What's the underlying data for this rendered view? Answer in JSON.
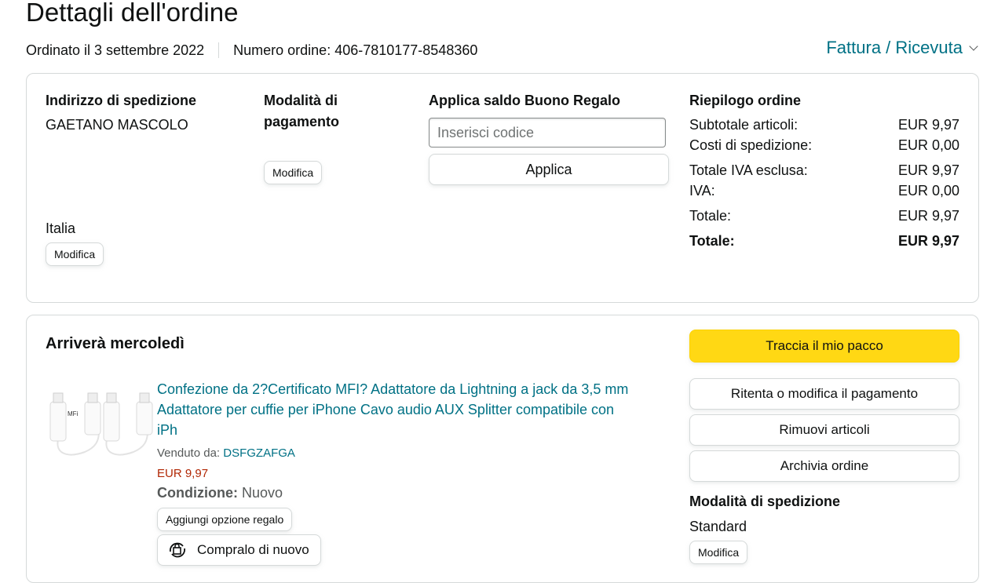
{
  "page": {
    "title": "Dettagli dell'ordine",
    "ordered_on": "Ordinato il 3 settembre 2022",
    "order_number": "Numero ordine: 406-7810177-8548360",
    "invoice_label": "Fattura / Ricevuta"
  },
  "shipping_address": {
    "heading": "Indirizzo di spedizione",
    "name": "GAETANO MASCOLO",
    "country": "Italia",
    "edit_label": "Modifica"
  },
  "payment": {
    "heading_line1": "Modalità di",
    "heading_line2": "pagamento",
    "edit_label": "Modifica"
  },
  "gift_card": {
    "heading": "Applica saldo Buono Regalo",
    "placeholder": "Inserisci codice",
    "apply_label": "Applica"
  },
  "summary": {
    "heading": "Riepilogo ordine",
    "rows": [
      {
        "label": "Subtotale articoli:",
        "value": "EUR 9,97"
      },
      {
        "label": "Costi di spedizione:",
        "value": "EUR 0,00"
      },
      {
        "label": "Totale IVA esclusa:",
        "value": "EUR 9,97"
      },
      {
        "label": "IVA:",
        "value": "EUR 0,00"
      },
      {
        "label": "Totale:",
        "value": "EUR 9,97"
      },
      {
        "label": "Totale:",
        "value": "EUR 9,97"
      }
    ]
  },
  "shipment": {
    "heading": "Arriverà mercoledì",
    "item": {
      "title_line1": "Confezione da 2?Certificato MFI? Adattatore da Lightning a jack da 3,5 mm",
      "title_line2": "Adattatore per cuffie per iPhone Cavo audio AUX Splitter compatibile con",
      "title_line3": "iPh",
      "sold_by_label": "Venduto da:",
      "seller": "DSFGZAFGA",
      "price": "EUR 9,97",
      "condition_label": "Condizione:",
      "condition_value": "Nuovo",
      "gift_option_label": "Aggiungi opzione regalo",
      "buy_again_label": "Compralo di nuovo",
      "thumb_mark": "MFi"
    },
    "actions": {
      "track": "Traccia il mio pacco",
      "retry_payment": "Ritenta o modifica il pagamento",
      "remove_items": "Rimuovi articoli",
      "archive": "Archivia ordine"
    },
    "shipping_method": {
      "heading": "Modalità di spedizione",
      "value": "Standard",
      "edit_label": "Modifica"
    }
  },
  "colors": {
    "link": "#007185",
    "price": "#b12704",
    "primary_button": "#ffd814",
    "border": "#d5d9d9"
  }
}
